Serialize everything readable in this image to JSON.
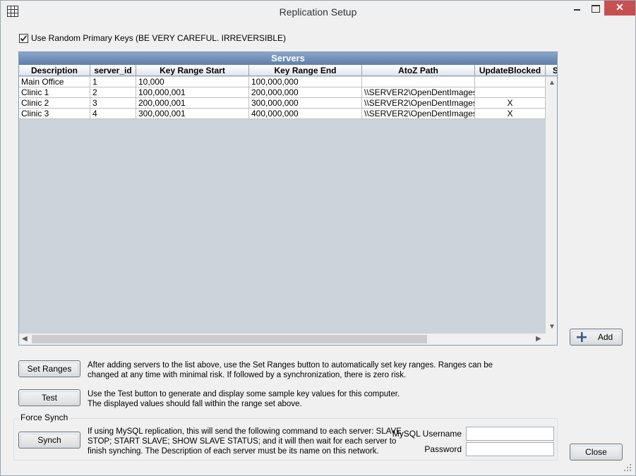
{
  "window": {
    "title": "Replication Setup"
  },
  "options": {
    "random_keys_label": "Use Random Primary Keys (BE VERY CAREFUL.  IRREVERSIBLE)",
    "random_keys_checked": true
  },
  "grid": {
    "title": "Servers",
    "columns": [
      "Description",
      "server_id",
      "Key Range Start",
      "Key Range End",
      "AtoZ Path",
      "UpdateBlocked",
      "S"
    ],
    "rows": [
      [
        "Main Office",
        "1",
        "10,000",
        "100,000,000",
        "",
        "",
        ""
      ],
      [
        "Clinic 1",
        "2",
        "100,000,001",
        "200,000,000",
        "\\\\SERVER2\\OpenDentImages",
        "",
        ""
      ],
      [
        "Clinic 2",
        "3",
        "200,000,001",
        "300,000,000",
        "\\\\SERVER2\\OpenDentImages",
        "X",
        ""
      ],
      [
        "Clinic 3",
        "4",
        "300,000,001",
        "400,000,000",
        "\\\\SERVER2\\OpenDentImages",
        "X",
        ""
      ]
    ]
  },
  "buttons": {
    "add": "Add",
    "set_ranges": "Set Ranges",
    "test": "Test",
    "synch": "Synch",
    "close": "Close"
  },
  "descriptions": {
    "set_ranges_line1": "After adding servers to the list above, use the Set Ranges button to automatically set key ranges.  Ranges can be",
    "set_ranges_line2": "changed at any time with minimal risk.  If followed by a synchronization, there is zero risk.",
    "test_line1": "Use the Test button to generate and display some sample key values for this computer.",
    "test_line2": "The displayed values should fall within the range set above."
  },
  "force_synch": {
    "legend": "Force Synch",
    "desc_line1": "If using MySQL replication, this will send the following command to each server:  SLAVE",
    "desc_line2": "STOP; START SLAVE; SHOW SLAVE STATUS; and it will then wait for each server to",
    "desc_line3": "finish synching.  The Description of each server must be its name on this network.",
    "username_label": "MySQL Username",
    "username_value": "",
    "password_label": "Password",
    "password_value": ""
  },
  "icons": {
    "app": "grid-icon",
    "add": "plus-icon",
    "check": "checkmark-icon"
  }
}
